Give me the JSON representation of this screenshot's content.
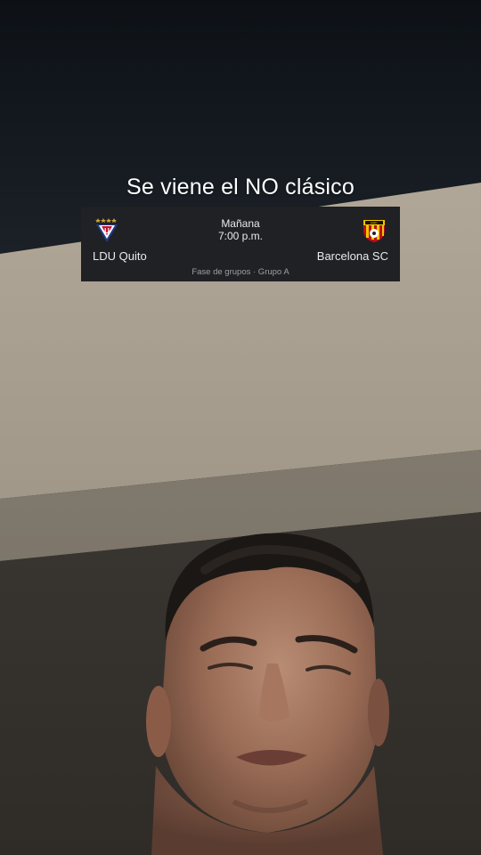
{
  "caption": "Se viene el NO clásico",
  "match": {
    "day": "Mañana",
    "time": "7:00 p.m.",
    "stage": "Fase de grupos · Grupo A",
    "home_team": {
      "name": "LDU Quito",
      "logo": "ldu-quito-crest-icon"
    },
    "away_team": {
      "name": "Barcelona SC",
      "logo": "barcelona-sc-crest-icon"
    }
  },
  "colors": {
    "card_background": "#202124",
    "card_text": "#e8eaed",
    "card_subtext": "#9aa0a6",
    "caption_text": "#ffffff"
  }
}
